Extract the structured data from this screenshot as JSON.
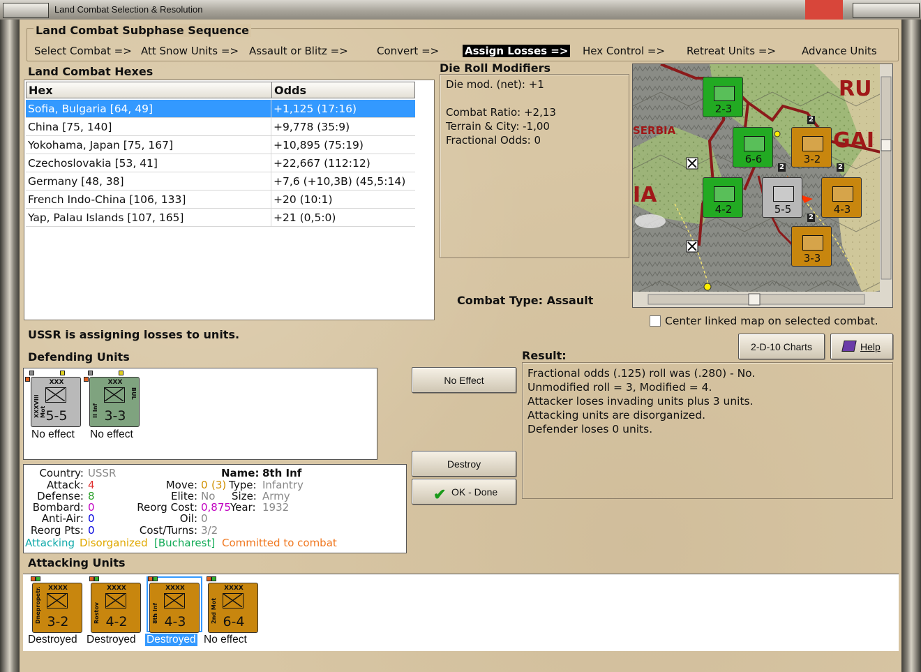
{
  "window": {
    "title": "Land Combat Selection & Resolution"
  },
  "sequence": {
    "title": "Land Combat Subphase Sequence",
    "steps": [
      "Select Combat =>",
      "Att Snow Units =>",
      "Assault or Blitz =>",
      "Convert =>",
      "Assign Losses =>",
      "Hex Control =>",
      "Retreat Units =>",
      "Advance Units"
    ],
    "active_step": "Assign Losses =>"
  },
  "hexes": {
    "title": "Land Combat Hexes",
    "col_hex": "Hex",
    "col_odds": "Odds",
    "rows": [
      {
        "hex": "Sofia, Bulgaria [64, 49]",
        "odds": "+1,125 (17:16)"
      },
      {
        "hex": "China [75, 140]",
        "odds": "+9,778 (35:9)"
      },
      {
        "hex": "Yokohama, Japan [75, 167]",
        "odds": "+10,895 (75:19)"
      },
      {
        "hex": "Czechoslovakia [53, 41]",
        "odds": "+22,667 (112:12)"
      },
      {
        "hex": "Germany [48, 38]",
        "odds": "+7,6 (+10,3B) (45,5:14)"
      },
      {
        "hex": "French Indo-China [106, 133]",
        "odds": "+20 (10:1)"
      },
      {
        "hex": "Yap, Palau Islands [107, 165]",
        "odds": "+21 (0,5:0)"
      }
    ]
  },
  "die_roll": {
    "title": "Die Roll Modifiers",
    "net": "Die mod. (net): +1",
    "ratio": "Combat Ratio: +2,13",
    "terrain": "Terrain & City: -1,00",
    "fractional": "Fractional Odds: 0"
  },
  "combat_type": "Combat Type:  Assault",
  "map": {
    "labels": [
      "RU",
      "SERBIA",
      "GAI",
      "IA"
    ],
    "units": [
      {
        "str": "2-3",
        "color": "#22aa22"
      },
      {
        "str": "6-6",
        "color": "#22aa22"
      },
      {
        "str": "3-2",
        "color": "#c8860e"
      },
      {
        "str": "4-2",
        "color": "#22aa22"
      },
      {
        "str": "5-5",
        "color": "#b8b8b8"
      },
      {
        "str": "4-3",
        "color": "#c8860e"
      },
      {
        "str": "3-3",
        "color": "#c8860e"
      }
    ],
    "stack_badges": [
      "2",
      "2",
      "2",
      "2"
    ]
  },
  "center_map_label": "Center linked map on selected combat.",
  "buttons": {
    "charts": "2-D-10 Charts",
    "help": "Help",
    "no_effect": "No Effect",
    "destroy": "Destroy",
    "ok_done": "OK - Done"
  },
  "status_text": "USSR is assigning losses to units.",
  "result": {
    "title": "Result:",
    "lines": [
      "Fractional odds (.125) roll was (.280)  - No.",
      "Unmodified roll = 3, Modified = 4.",
      "Attacker loses invading units plus 3 units.",
      "Attacking units are disorganized.",
      "Defender loses 0 units."
    ]
  },
  "defending": {
    "title": "Defending Units",
    "units": [
      {
        "name": "XXXVIII Mot",
        "size": "XXX",
        "strength": "5-5",
        "nat": "",
        "status": "No effect",
        "color": "#b9b9b9"
      },
      {
        "name": "II Inf",
        "size": "XXX",
        "strength": "3-3",
        "nat": "BUL",
        "status": "No effect",
        "color": "#7fa37f"
      }
    ]
  },
  "info": {
    "country_label": "Country:",
    "country": "USSR",
    "attack_label": "Attack:",
    "attack": "4",
    "defense_label": "Defense:",
    "defense": "8",
    "bombard_label": "Bombard:",
    "bombard": "0",
    "antiair_label": "Anti-Air:",
    "antiair": "0",
    "reorg_label": "Reorg Pts:",
    "reorg": "0",
    "name_label": "Name:",
    "name": "8th  Inf",
    "move_label": "Move:",
    "move": "0",
    "move_paren": "(3)",
    "elite_label": "Elite:",
    "elite": "No",
    "reorg_cost_label": "Reorg Cost:",
    "reorg_cost": "0,875",
    "oil_label": "Oil:",
    "oil": "0",
    "cost_label": "Cost/Turns:",
    "cost": "3/2",
    "type_label": "Type:",
    "type": "Infantry",
    "size_label": "Size:",
    "size": "Army",
    "year_label": "Year:",
    "year": "1932",
    "tags": [
      "Attacking",
      "Disorganized",
      "[Bucharest]",
      "Committed to combat"
    ]
  },
  "attacking": {
    "title": "Attacking Units",
    "units": [
      {
        "name": "Dnepropetr.",
        "size": "XXXX",
        "strength": "3-2",
        "status": "Destroyed",
        "selected": false
      },
      {
        "name": "Rostov",
        "size": "XXXX",
        "strength": "4-2",
        "status": "Destroyed",
        "selected": false
      },
      {
        "name": "8th Inf",
        "size": "XXXX",
        "strength": "4-3",
        "status": "Destroyed",
        "selected": true
      },
      {
        "name": "2nd Mot",
        "size": "XXXX",
        "strength": "6-4",
        "status": "No effect",
        "selected": false
      }
    ]
  },
  "colors": {
    "panel": "#d8c6a4",
    "selection": "#3399ff",
    "soviet": "#c8860e",
    "german": "#b9b9b9",
    "attack": "#e03030",
    "defense": "#2aa02a",
    "bombard": "#c000c0",
    "antiair": "#0000dd",
    "tag_attacking": "#11aaaa",
    "tag_disorg": "#e0a800",
    "tag_city": "#11aa55",
    "tag_committed": "#f07820"
  }
}
